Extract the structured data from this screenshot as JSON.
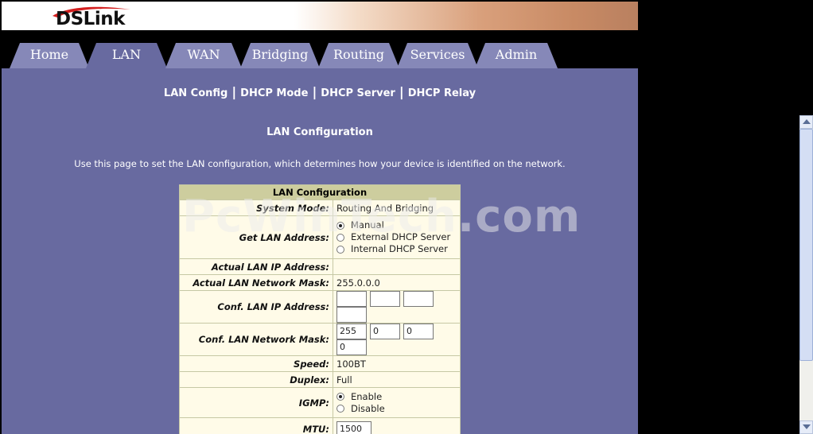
{
  "header": {
    "logo_text": "DSLink",
    "logo_colors": {
      "swoosh": "#d42020",
      "text": "#111111"
    }
  },
  "tabs": [
    {
      "label": "Home",
      "active": false
    },
    {
      "label": "LAN",
      "active": true
    },
    {
      "label": "WAN",
      "active": false
    },
    {
      "label": "Bridging",
      "active": false
    },
    {
      "label": "Routing",
      "active": false
    },
    {
      "label": "Services",
      "active": false
    },
    {
      "label": "Admin",
      "active": false
    }
  ],
  "subnav": [
    "LAN Config",
    "DHCP Mode",
    "DHCP Server",
    "DHCP Relay"
  ],
  "page": {
    "title": "LAN Configuration",
    "description": "Use this page to set the LAN configuration, which determines how your device is identified on the network."
  },
  "table": {
    "header": "LAN Configuration",
    "rows": {
      "system_mode": {
        "label": "System Mode:",
        "value": "Routing And Bridging"
      },
      "get_lan_address": {
        "label": "Get LAN Address:",
        "options": [
          "Manual",
          "External DHCP Server",
          "Internal DHCP Server"
        ],
        "selected": "Manual"
      },
      "actual_lan_ip": {
        "label": "Actual LAN IP Address:",
        "value": ""
      },
      "actual_lan_mask": {
        "label": "Actual LAN Network Mask:",
        "value": "255.0.0.0"
      },
      "conf_lan_ip": {
        "label": "Conf. LAN IP Address:",
        "octets": [
          "",
          "",
          "",
          ""
        ]
      },
      "conf_lan_mask": {
        "label": "Conf. LAN Network Mask:",
        "octets": [
          "255",
          "0",
          "0",
          "0"
        ]
      },
      "speed": {
        "label": "Speed:",
        "value": "100BT"
      },
      "duplex": {
        "label": "Duplex:",
        "value": "Full"
      },
      "igmp": {
        "label": "IGMP:",
        "options": [
          "Enable",
          "Disable"
        ],
        "selected": "Enable"
      },
      "mtu": {
        "label": "MTU:",
        "value": "1500"
      }
    }
  },
  "watermark": "PcWinTech.com",
  "colors": {
    "page_bg": "#686aa0",
    "tab_bg": "#8688b8",
    "table_bg": "#fffbe8",
    "table_header_bg": "#cdcd9e"
  }
}
